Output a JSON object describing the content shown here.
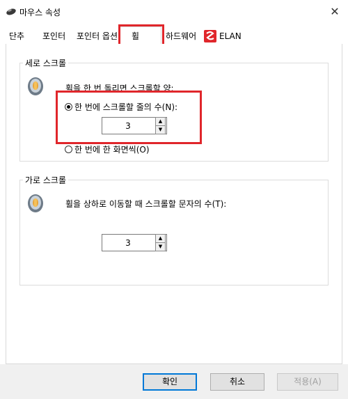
{
  "window": {
    "title": "마우스 속성",
    "close_glyph": "✕"
  },
  "tabs": [
    {
      "label": "단추"
    },
    {
      "label": "포인터"
    },
    {
      "label": "포인터 옵션"
    },
    {
      "label": "휠",
      "active": true
    },
    {
      "label": "하드웨어"
    },
    {
      "label": "ELAN"
    }
  ],
  "vertical_scroll": {
    "group_title": "세로 스크롤",
    "description": "휠을 한 번 돌리면 스크롤할 양:",
    "option_lines": {
      "label": "한 번에 스크롤할 줄의 수(N):",
      "selected": true
    },
    "lines_value": "3",
    "option_screen": {
      "label": "한 번에 한 화면씩(O)",
      "selected": false
    }
  },
  "horizontal_scroll": {
    "group_title": "가로 스크롤",
    "description": "휠을 상하로 이동할 때 스크롤할 문자의 수(T):",
    "chars_value": "3"
  },
  "buttons": {
    "ok": "확인",
    "cancel": "취소",
    "apply": "적용(A)"
  },
  "colors": {
    "highlight": "#e0262b",
    "default_button_border": "#0078d7",
    "elan_logo": "#e0262b"
  },
  "icons": {
    "spin_up": "▲",
    "spin_down": "▼"
  }
}
